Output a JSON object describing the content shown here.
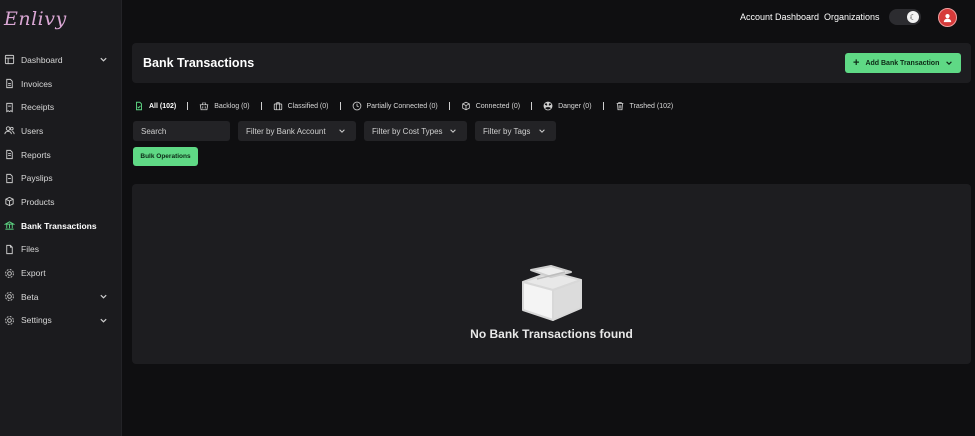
{
  "brand": {
    "logo_text": "Enlivy"
  },
  "topbar": {
    "account_dashboard": "Account Dashboard",
    "organizations": "Organizations"
  },
  "sidebar": {
    "items": [
      {
        "label": "Dashboard",
        "icon": "grid-icon",
        "has_chevron": true
      },
      {
        "label": "Invoices",
        "icon": "document-icon"
      },
      {
        "label": "Receipts",
        "icon": "receipt-icon"
      },
      {
        "label": "Users",
        "icon": "users-icon"
      },
      {
        "label": "Reports",
        "icon": "report-icon"
      },
      {
        "label": "Payslips",
        "icon": "payslip-icon"
      },
      {
        "label": "Products",
        "icon": "box-icon"
      },
      {
        "label": "Bank Transactions",
        "icon": "bank-icon",
        "active": true
      },
      {
        "label": "Files",
        "icon": "file-icon"
      },
      {
        "label": "Export",
        "icon": "gear-icon"
      },
      {
        "label": "Beta",
        "icon": "gear-icon",
        "has_chevron": true
      },
      {
        "label": "Settings",
        "icon": "gear-icon",
        "has_chevron": true
      }
    ]
  },
  "header": {
    "title": "Bank Transactions",
    "add_button": "Add Bank Transaction"
  },
  "tabs": [
    {
      "label": "All (102)",
      "icon": "file-check-icon",
      "active": true
    },
    {
      "label": "Backlog (0)",
      "icon": "basket-icon"
    },
    {
      "label": "Classified (0)",
      "icon": "briefcase-icon"
    },
    {
      "label": "Partially Connected (0)",
      "icon": "clock-icon"
    },
    {
      "label": "Connected (0)",
      "icon": "cube-icon"
    },
    {
      "label": "Danger (0)",
      "icon": "hazard-icon"
    },
    {
      "label": "Trashed (102)",
      "icon": "trash-icon"
    }
  ],
  "filters": {
    "search_placeholder": "Search",
    "bank_account": "Filter by Bank Account",
    "cost_types": "Filter by Cost Types",
    "tags": "Filter by Tags"
  },
  "bulk_button": "Bulk Operations",
  "empty_state": {
    "message": "No Bank Transactions found"
  },
  "colors": {
    "accent": "#5fd985",
    "background": "#0f0f11",
    "card": "#1d1d20",
    "sidebar": "#1b1b1e"
  }
}
